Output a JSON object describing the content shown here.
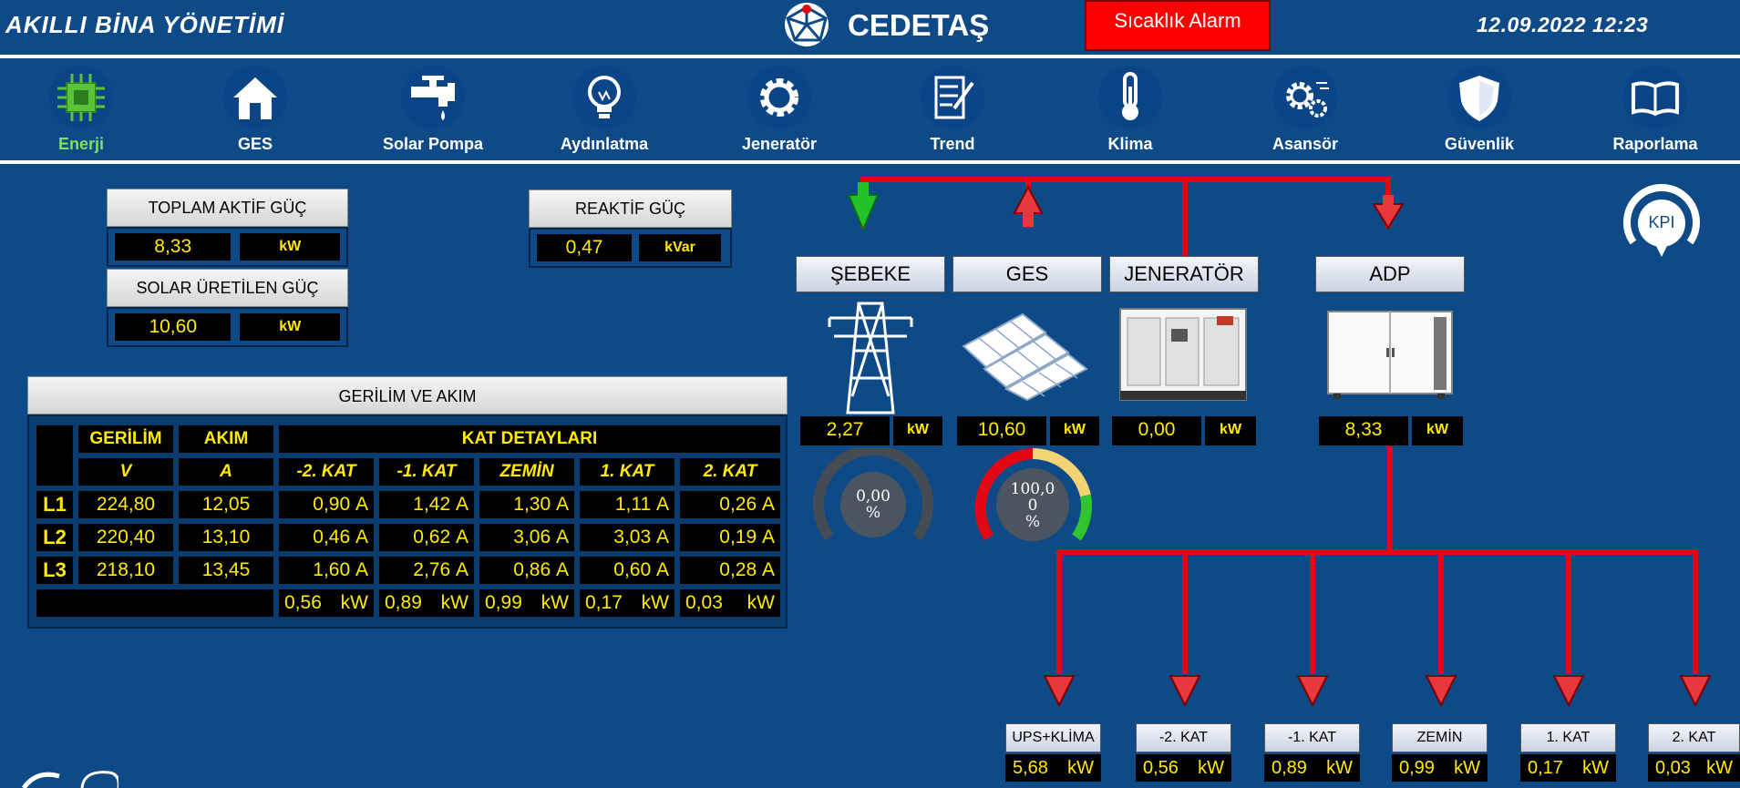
{
  "header": {
    "title": "AKILLI BİNA YÖNETİMİ",
    "brand": "CEDETAŞ",
    "alarm_label": "Sıcaklık Alarm",
    "datetime": "12.09.2022 12:23"
  },
  "nav": {
    "items": [
      {
        "label": "Enerji",
        "icon": "chip-icon",
        "active": true
      },
      {
        "label": "GES",
        "icon": "home-icon"
      },
      {
        "label": "Solar Pompa",
        "icon": "faucet-icon"
      },
      {
        "label": "Aydınlatma",
        "icon": "bulb-icon"
      },
      {
        "label": "Jeneratör",
        "icon": "gear-icon"
      },
      {
        "label": "Trend",
        "icon": "trend-icon"
      },
      {
        "label": "Klima",
        "icon": "thermometer-icon"
      },
      {
        "label": "Asansör",
        "icon": "gears-icon"
      },
      {
        "label": "Güvenlik",
        "icon": "shield-icon"
      },
      {
        "label": "Raporlama",
        "icon": "book-icon"
      }
    ]
  },
  "power": {
    "total_active_title": "TOPLAM AKTİF GÜÇ",
    "total_active_value": "8,33",
    "total_active_unit": "kW",
    "solar_title": "SOLAR ÜRETİLEN GÜÇ",
    "solar_value": "10,60",
    "solar_unit": "kW",
    "reactive_title": "REAKTİF GÜÇ",
    "reactive_value": "0,47",
    "reactive_unit": "kVar"
  },
  "table": {
    "title": "GERİLİM VE AKIM",
    "h_voltage": "GERİLİM",
    "h_current": "AKIM",
    "h_floors": "KAT DETAYLARI",
    "u_voltage": "V",
    "u_current": "A",
    "floors": [
      "-2. KAT",
      "-1. KAT",
      "ZEMİN",
      "1. KAT",
      "2. KAT"
    ],
    "rows": [
      {
        "label": "L1",
        "v": "224,80",
        "a": "12,05",
        "f": [
          "0,90",
          "1,42",
          "1,30",
          "1,11",
          "0,26"
        ]
      },
      {
        "label": "L2",
        "v": "220,40",
        "a": "13,10",
        "f": [
          "0,46",
          "0,62",
          "3,06",
          "3,03",
          "0,19"
        ]
      },
      {
        "label": "L3",
        "v": "218,10",
        "a": "13,45",
        "f": [
          "1,60",
          "2,76",
          "0,86",
          "0,60",
          "0,28"
        ]
      }
    ],
    "amp_unit": "A",
    "totals": [
      "0,56",
      "0,89",
      "0,99",
      "0,17",
      "0,03"
    ],
    "kw_unit": "kW"
  },
  "sources": {
    "grid": {
      "label": "ŞEBEKE",
      "value": "2,27",
      "unit": "kW",
      "gauge": "0,00\n%",
      "gauge_pct": 0
    },
    "ges": {
      "label": "GES",
      "value": "10,60",
      "unit": "kW",
      "gauge": "100,0\n0\n%",
      "gauge_pct": 100
    },
    "gen": {
      "label": "JENERATÖR",
      "value": "0,00",
      "unit": "kW"
    },
    "adp": {
      "label": "ADP",
      "value": "8,33",
      "unit": "kW"
    }
  },
  "kpi_label": "KPI",
  "floors_out": [
    {
      "label": "UPS+KLİMA",
      "value": "5,68",
      "unit": "kW"
    },
    {
      "label": "-2. KAT",
      "value": "0,56",
      "unit": "kW"
    },
    {
      "label": "-1. KAT",
      "value": "0,89",
      "unit": "kW"
    },
    {
      "label": "ZEMİN",
      "value": "0,99",
      "unit": "kW"
    },
    {
      "label": "1. KAT",
      "value": "0,17",
      "unit": "kW"
    },
    {
      "label": "2. KAT",
      "value": "0,03",
      "unit": "kW"
    }
  ],
  "colors": {
    "background": "#0d4a87",
    "value_text": "#ffea00",
    "alarm": "#ff0000",
    "power_line": "#e30613",
    "active_nav": "#7ee25a"
  }
}
